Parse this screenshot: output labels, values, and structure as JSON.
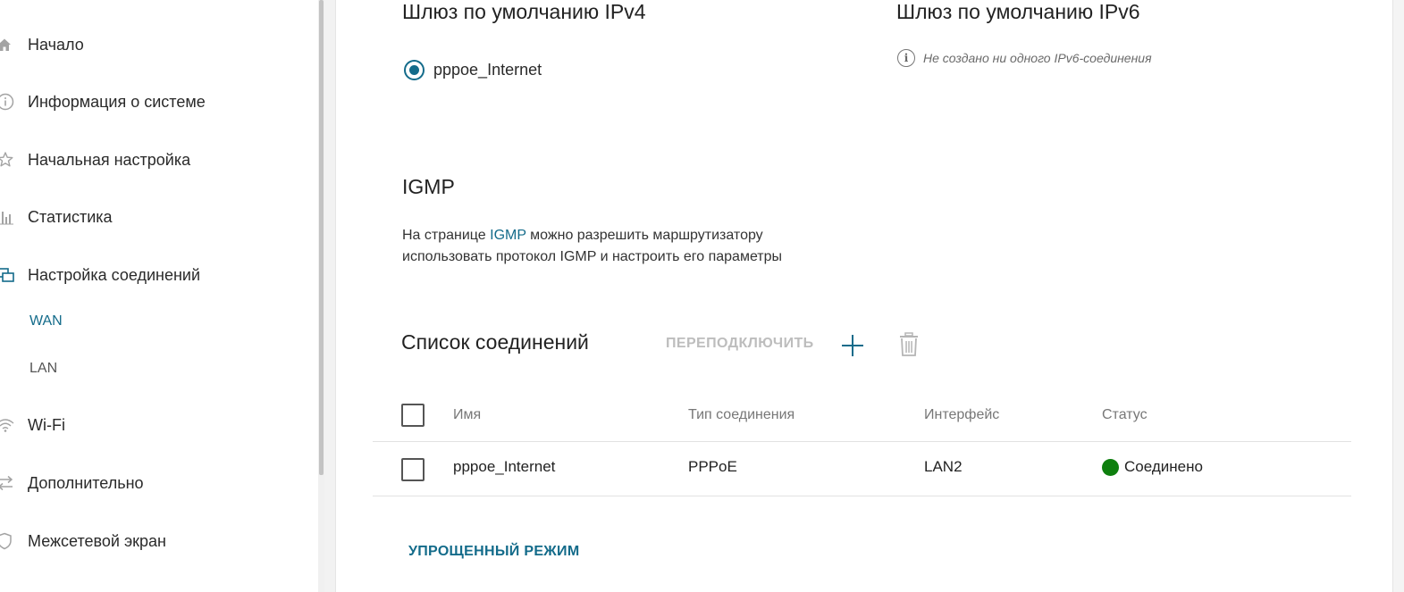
{
  "sidebar": {
    "items": [
      {
        "label": "Начало",
        "icon": "home-icon"
      },
      {
        "label": "Информация о системе",
        "icon": "info-icon"
      },
      {
        "label": "Начальная настройка",
        "icon": "star-icon"
      },
      {
        "label": "Статистика",
        "icon": "chart-icon"
      },
      {
        "label": "Настройка соединений",
        "icon": "connections-icon"
      },
      {
        "label": "Wi-Fi",
        "icon": "wifi-icon"
      },
      {
        "label": "Дополнительно",
        "icon": "arrows-icon"
      },
      {
        "label": "Межсетевой экран",
        "icon": "shield-icon"
      }
    ],
    "subitems": [
      {
        "label": "WAN",
        "active": true
      },
      {
        "label": "LAN",
        "active": false
      }
    ]
  },
  "gateway": {
    "ipv4_title": "Шлюз по умолчанию IPv4",
    "ipv4_selected": "pppoe_Internet",
    "ipv6_title": "Шлюз по умолчанию IPv6",
    "ipv6_note": "Не создано ни одного IPv6-соединения"
  },
  "igmp": {
    "title": "IGMP",
    "desc_prefix": "На странице ",
    "desc_link": "IGMP",
    "desc_suffix": " можно разрешить маршрутизатору использовать протокол IGMP и настроить его параметры"
  },
  "connections": {
    "title": "Список соединений",
    "reconnect_label": "ПЕРЕПОДКЛЮЧИТЬ",
    "columns": [
      "Имя",
      "Тип соединения",
      "Интерфейс",
      "Статус"
    ],
    "rows": [
      {
        "name": "pppoe_Internet",
        "type": "PPPoE",
        "interface": "LAN2",
        "status": "Соединено"
      }
    ]
  },
  "simple_mode_label": "УПРОЩЕННЫЙ РЕЖИМ",
  "colors": {
    "accent": "#136b8a",
    "status_ok": "#0e7f0e",
    "disabled": "#bdbdbd"
  }
}
